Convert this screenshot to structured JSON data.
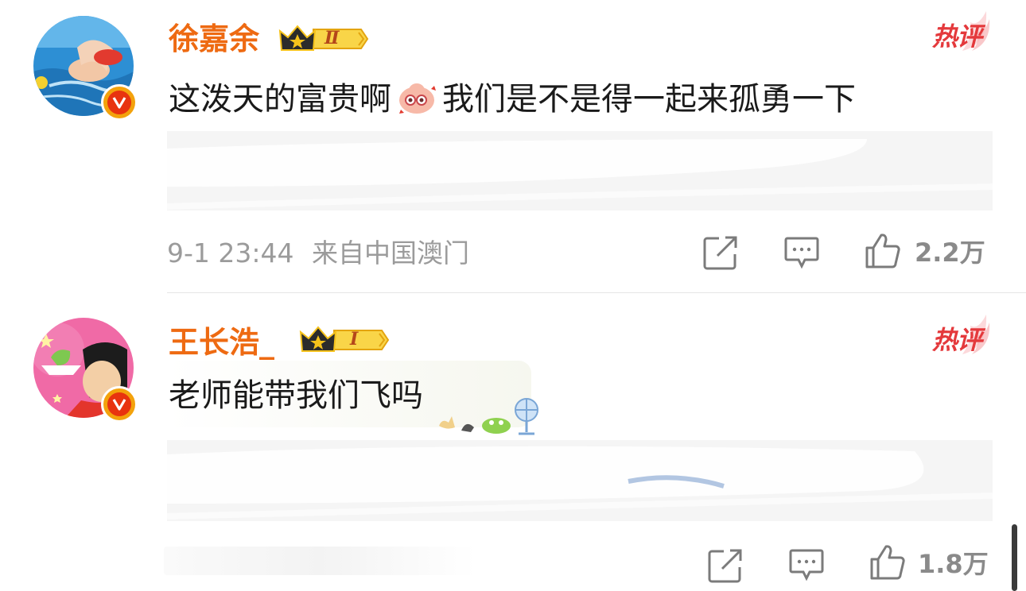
{
  "comments": [
    {
      "username": "徐嘉余",
      "level": "Ⅱ",
      "hot_label": "热评",
      "text_part1": "这泼天的富贵啊",
      "text_part2": "我们是不是得一起来孤勇一下",
      "emoji_name": "shy-face-emoji",
      "timestamp": "9-1 23:44",
      "location": "来自中国澳门",
      "like_count": "2.2万"
    },
    {
      "username": "王长浩_",
      "level": "Ⅰ",
      "hot_label": "热评",
      "text": "老师能带我们飞吗",
      "like_count": "1.8万"
    }
  ],
  "colors": {
    "username": "#ee6a12",
    "hot_label": "#e4393c",
    "verified_badge": "#e8330f",
    "crown_gold": "#f5c21b"
  }
}
